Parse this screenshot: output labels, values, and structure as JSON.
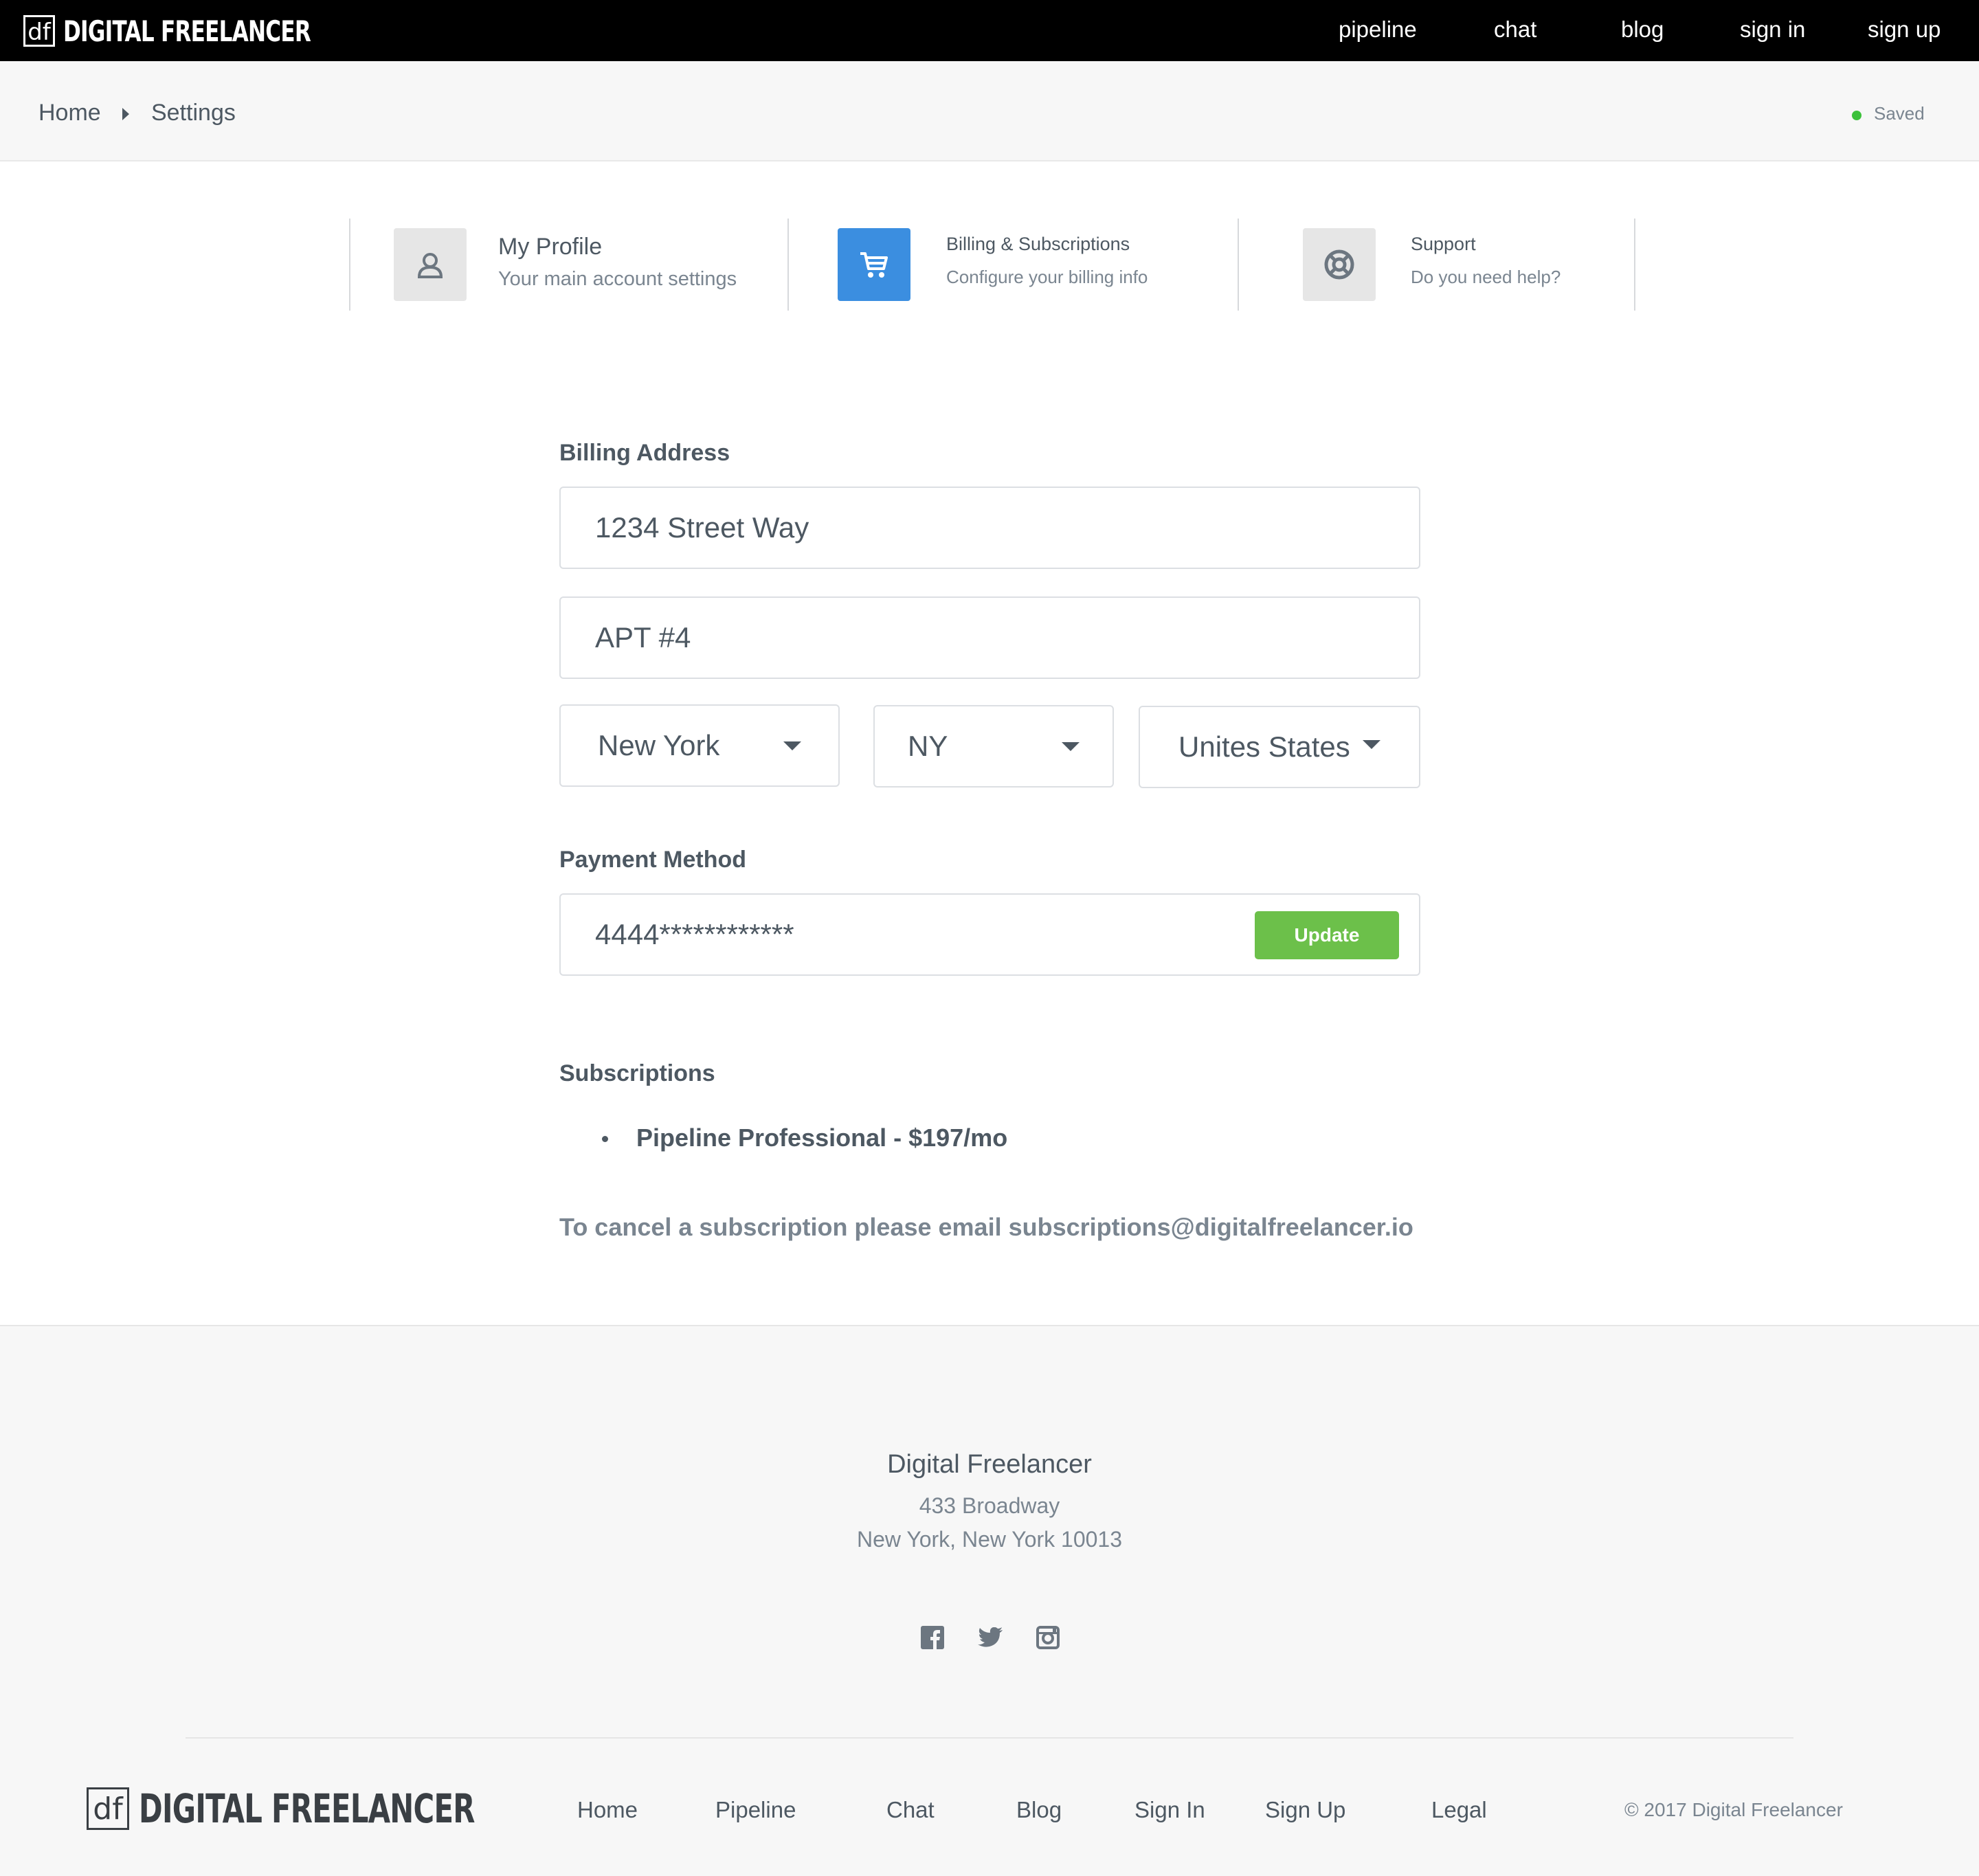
{
  "navbar": {
    "brand_mark": "df",
    "brand_name": "DIGITAL FREELANCER",
    "links": [
      "pipeline",
      "chat",
      "blog",
      "sign in",
      "sign up"
    ]
  },
  "breadcrumb": {
    "home": "Home",
    "current": "Settings"
  },
  "status": {
    "label": "Saved",
    "color": "#3cc13b"
  },
  "tabs": [
    {
      "title": "My Profile",
      "subtitle": "Your main account settings",
      "icon": "user-icon",
      "active": false
    },
    {
      "title": "Billing & Subscriptions",
      "subtitle": "Configure your billing info",
      "icon": "cart-icon",
      "active": true
    },
    {
      "title": "Support",
      "subtitle": "Do you need help?",
      "icon": "lifebuoy-icon",
      "active": false
    }
  ],
  "billing": {
    "label": "Billing Address",
    "address1": "1234 Street Way",
    "address2": "APT #4",
    "city": "New York",
    "state": "NY",
    "country": "Unites States"
  },
  "payment": {
    "label": "Payment Method",
    "card": "4444************",
    "update_label": "Update"
  },
  "subscriptions": {
    "label": "Subscriptions",
    "items": [
      "Pipeline Professional - $197/mo"
    ],
    "note": "To cancel a subscription please email subscriptions@digitalfreelancer.io"
  },
  "footer": {
    "company": "Digital Freelancer",
    "address_line1": "433 Broadway",
    "address_line2": "New York, New York 10013",
    "social": [
      "facebook-icon",
      "twitter-icon",
      "instagram-icon"
    ],
    "brand_mark": "df",
    "brand_name": "DIGITAL FREELANCER",
    "links": [
      "Home",
      "Pipeline",
      "Chat",
      "Blog",
      "Sign In",
      "Sign Up",
      "Legal"
    ],
    "copyright": "© 2017 Digital Freelancer"
  },
  "colors": {
    "accent": "#3b8ee0",
    "update_button": "#6cc04a",
    "navbar": "#000000",
    "text": "#4d5862"
  }
}
